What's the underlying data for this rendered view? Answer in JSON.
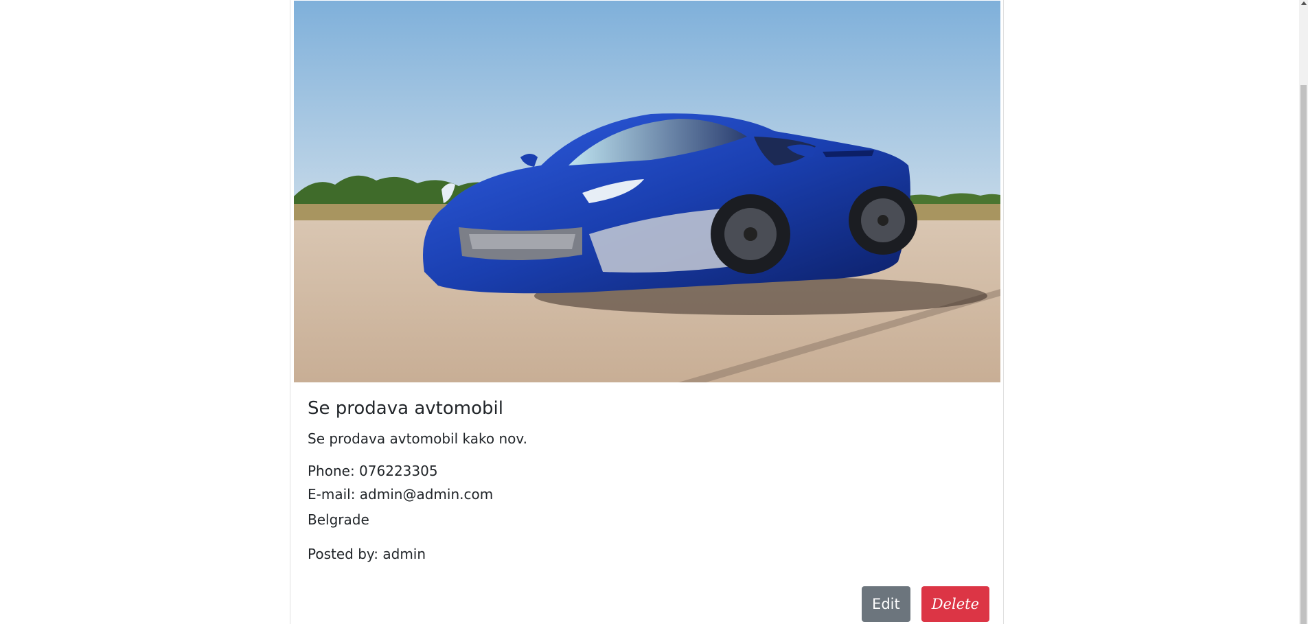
{
  "listing": {
    "title": "Se prodava avtomobil",
    "description": "Se prodava avtomobil kako nov.",
    "phone": "Phone: 076223305",
    "email": "E-mail: admin@admin.com",
    "city": "Belgrade",
    "posted_by": "Posted by: admin",
    "image_alt": "Blue sports car on a runway"
  },
  "actions": {
    "edit_label": "Edit",
    "delete_label": "Delete"
  },
  "colors": {
    "edit_button": "#6c757d",
    "delete_button": "#dc3545",
    "car_body": "#1a3fb0",
    "sky": "#9cc0de"
  }
}
